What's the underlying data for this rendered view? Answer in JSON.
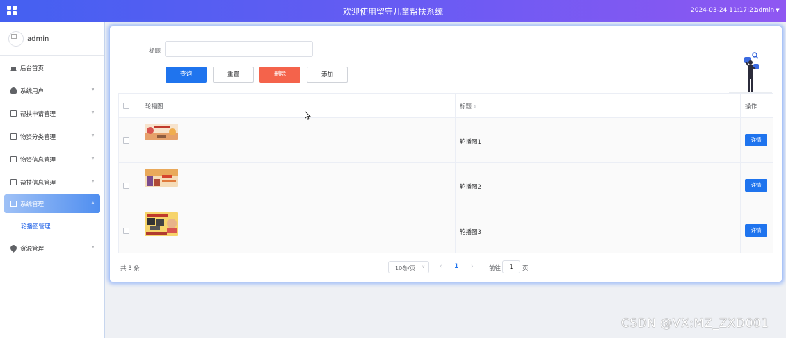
{
  "header": {
    "title": "欢迎使用留守儿童帮扶系统",
    "datetime": "2024-03-24 11:17:21",
    "user": "admin",
    "menu_icon": "grid-menu-icon",
    "gradient_start": "#4460f1",
    "gradient_end": "#8f57f2"
  },
  "sidebar": {
    "profile_name": "admin",
    "items": [
      {
        "label": "后台首页",
        "icon": "home-icon"
      },
      {
        "label": "系统用户",
        "icon": "user-icon"
      },
      {
        "label": "帮扶申请管理",
        "icon": "document-icon"
      },
      {
        "label": "物资分类管理",
        "icon": "document-icon"
      },
      {
        "label": "物资信息管理",
        "icon": "document-icon"
      },
      {
        "label": "帮扶信息管理",
        "icon": "document-icon"
      },
      {
        "label": "系统管理",
        "icon": "picture-icon",
        "active": true
      },
      {
        "label": "资源管理",
        "icon": "location-pin-icon"
      }
    ],
    "sub_item": "轮播图管理"
  },
  "search": {
    "label": "标题",
    "value": "",
    "placeholder": ""
  },
  "buttons": {
    "query": "查询",
    "reset": "重置",
    "delete": "删除",
    "add": "添加"
  },
  "table": {
    "columns": [
      "轮播图",
      "标题",
      "操作"
    ],
    "rows": [
      {
        "title": "轮播图1",
        "action": "详情"
      },
      {
        "title": "轮播图2",
        "action": "详情"
      },
      {
        "title": "轮播图3",
        "action": "详情"
      }
    ]
  },
  "pagination": {
    "total_text": "共 3 条",
    "page_size": "10条/页",
    "current_page": "1",
    "goto_label": "前往",
    "goto_value": "1",
    "goto_unit": "页"
  },
  "colors": {
    "primary": "#1f74ee",
    "danger": "#f4634b",
    "active_menu": "#4f8ef0"
  },
  "watermark": "CSDN @VX:MZ_ZXD001"
}
